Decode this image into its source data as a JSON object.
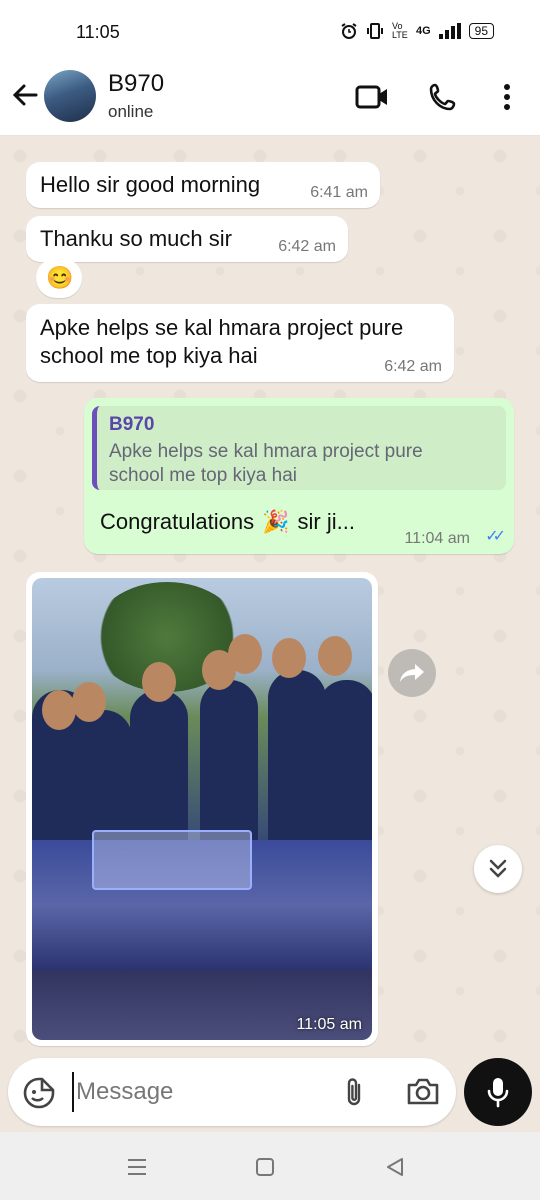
{
  "status": {
    "time": "11:05",
    "network": "4G",
    "volte": "Vo LTE",
    "battery": "95"
  },
  "header": {
    "name": "B970",
    "status": "online"
  },
  "messages": [
    {
      "text": "Hello sir good morning",
      "time": "6:41 am"
    },
    {
      "text": "Thanku so much sir",
      "time": "6:42 am"
    },
    {
      "emoji": "😊"
    },
    {
      "text_line1": "Apke helps se kal hmara project pure",
      "text_line2": "school me top kiya hai",
      "time": "6:42 am"
    }
  ],
  "reply": {
    "quote_author": "B970",
    "quote_line1": "Apke helps se kal hmara project pure",
    "quote_line2": "school me top kiya hai",
    "text_before": "Congratulations",
    "emoji": "🎉",
    "text_after": "sir ji...",
    "time": "11:04 am",
    "ticks": "✓✓"
  },
  "photo_message": {
    "time": "11:05 am"
  },
  "composer": {
    "placeholder": "Message"
  },
  "icons": {
    "back": "arrow-left-icon",
    "video": "video-call-icon",
    "call": "phone-icon",
    "menu": "more-vert-icon",
    "sticker": "sticker-icon",
    "attach": "paperclip-icon",
    "camera": "camera-icon",
    "mic": "mic-icon",
    "forward": "forward-icon",
    "scroll": "double-chevron-down-icon"
  },
  "colors": {
    "incoming": "#ffffff",
    "outgoing": "#d9fdd3",
    "tick": "#3b82f6",
    "background": "#efe7dd"
  }
}
